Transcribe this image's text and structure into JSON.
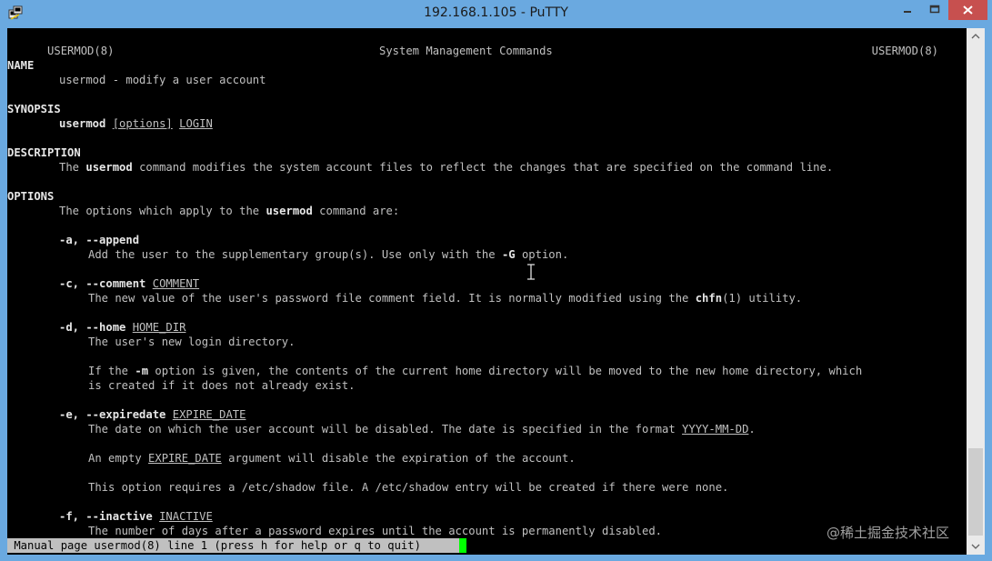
{
  "window": {
    "title": "192.168.1.105 - PuTTY",
    "icon": "putty-icon",
    "controls": [
      "minimize-icon",
      "maximize-icon",
      "close-icon"
    ]
  },
  "man": {
    "header_left": "USERMOD(8)",
    "header_center": "System Management Commands",
    "header_right": "USERMOD(8)",
    "name_heading": "NAME",
    "name_text": "usermod - modify a user account",
    "synopsis_heading": "SYNOPSIS",
    "synopsis_cmd": "usermod",
    "synopsis_options": "[options]",
    "synopsis_login": "LOGIN",
    "description_heading": "DESCRIPTION",
    "description_pre": "The ",
    "description_cmd": "usermod",
    "description_post": " command modifies the system account files to reflect the changes that are specified on the command line.",
    "options_heading": "OPTIONS",
    "options_intro_pre": "The options which apply to the ",
    "options_intro_cmd": "usermod",
    "options_intro_post": " command are:",
    "opt_a_flag": "-a, --append",
    "opt_a_desc_pre": "Add the user to the supplementary group(s). Use only with the ",
    "opt_a_desc_flag": "-G",
    "opt_a_desc_post": " option.",
    "opt_c_flag": "-c, --comment",
    "opt_c_arg": "COMMENT",
    "opt_c_desc_pre": "The new value of the user's password file comment field. It is normally modified using the ",
    "opt_c_desc_cmd": "chfn",
    "opt_c_desc_post": "(1) utility.",
    "opt_d_flag": "-d, --home",
    "opt_d_arg": "HOME_DIR",
    "opt_d_desc": "The user's new login directory.",
    "opt_d_desc2_pre": "If the ",
    "opt_d_desc2_flag": "-m",
    "opt_d_desc2_post": " option is given, the contents of the current home directory will be moved to the new home directory, which",
    "opt_d_desc3": "is created if it does not already exist.",
    "opt_e_flag": "-e, --expiredate",
    "opt_e_arg": "EXPIRE_DATE",
    "opt_e_desc_pre": "The date on which the user account will be disabled. The date is specified in the format ",
    "opt_e_desc_fmt": "YYYY-MM-DD",
    "opt_e_desc_post": ".",
    "opt_e_desc2_pre": "An empty ",
    "opt_e_desc2_arg": "EXPIRE_DATE",
    "opt_e_desc2_post": " argument will disable the expiration of the account.",
    "opt_e_desc3": "This option requires a /etc/shadow file. A /etc/shadow entry will be created if there were none.",
    "opt_f_flag": "-f, --inactive",
    "opt_f_arg": "INACTIVE",
    "opt_f_desc": "The number of days after a password expires until the account is permanently disabled."
  },
  "status": {
    "text": " Manual page usermod(8) line 1 (press h for help or q to quit)"
  },
  "watermark": {
    "text": "@稀土掘金技术社区"
  },
  "colors": {
    "titlebar": "#6aa9e0",
    "terminal_bg": "#000000",
    "terminal_fg": "#c0c0c0",
    "cursor": "#00ff00",
    "close_button": "#c7504f"
  }
}
